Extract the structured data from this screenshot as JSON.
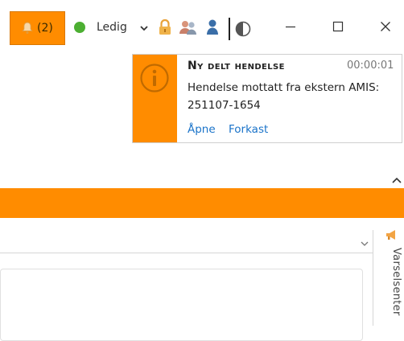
{
  "topbar": {
    "notification_count": "(2)",
    "status_label": "Ledig",
    "status_color": "#4caf32",
    "accent_color": "#ff8c00",
    "icons": [
      "bell-icon",
      "lock-icon",
      "users-icon",
      "person-icon",
      "contrast-icon"
    ]
  },
  "window_controls": [
    "minimize",
    "maximize",
    "close"
  ],
  "popup": {
    "title": "Ny delt hendelse",
    "time": "00:00:01",
    "message": "Hendelse mottatt fra ekstern AMIS: 251107-1654",
    "open_label": "Åpne",
    "dismiss_label": "Forkast",
    "icon": "info-icon"
  },
  "side_panel": {
    "label": "Varselsenter",
    "icon": "megaphone-icon"
  }
}
